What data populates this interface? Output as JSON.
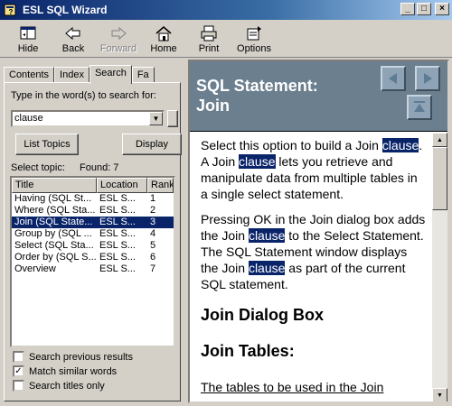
{
  "window": {
    "title": "ESL SQL Wizard"
  },
  "window_controls": {
    "minimize": "_",
    "maximize": "□",
    "close": "×"
  },
  "toolbar": {
    "hide": "Hide",
    "back": "Back",
    "forward": "Forward",
    "home": "Home",
    "print": "Print",
    "options": "Options"
  },
  "tabs": [
    "Contents",
    "Index",
    "Search",
    "Fa"
  ],
  "search": {
    "prompt": "Type in the word(s) to search for:",
    "value": "clause",
    "list_topics_button": "List Topics",
    "display_button": "Display",
    "select_topic_label": "Select topic:",
    "found_label": "Found: 7"
  },
  "results": {
    "columns": [
      "Title",
      "Location",
      "Rank"
    ],
    "rows": [
      [
        "Having (SQL St...",
        "ESL S...",
        "1"
      ],
      [
        "Where (SQL Sta...",
        "ESL S...",
        "2"
      ],
      [
        "Join (SQL State...",
        "ESL S...",
        "3"
      ],
      [
        "Group by (SQL ...",
        "ESL S...",
        "4"
      ],
      [
        "Select (SQL Sta...",
        "ESL S...",
        "5"
      ],
      [
        "Order by (SQL S...",
        "ESL S...",
        "6"
      ],
      [
        "Overview",
        "ESL S...",
        "7"
      ]
    ]
  },
  "options": [
    {
      "label": "Search previous results",
      "checked": false
    },
    {
      "label": "Match similar words",
      "checked": true
    },
    {
      "label": "Search titles only",
      "checked": false
    }
  ],
  "topic": {
    "title_line1": "SQL Statement:",
    "title_line2": "Join",
    "p1_a": "Select this option to build a Join ",
    "hl1": "clause",
    "p1_b": ".  A Join ",
    "hl2": "clause",
    "p1_c": " lets you retrieve and manipulate data from multiple tables in a single select statement.",
    "p2_a": "Pressing OK in the Join dialog box adds the Join ",
    "hl3": "clause",
    "p2_b": " to the Select Statement.  The SQL Statement window displays the Join ",
    "hl4": "clause",
    "p2_c": " as part of the current SQL statement.",
    "h2_1": "Join Dialog Box",
    "h2_2": "Join Tables:",
    "p3": "The tables to be used in the Join"
  },
  "colors": {
    "banner": "#6b7f8f",
    "selection": "#0a246a",
    "titlebar": "#0a246a"
  }
}
